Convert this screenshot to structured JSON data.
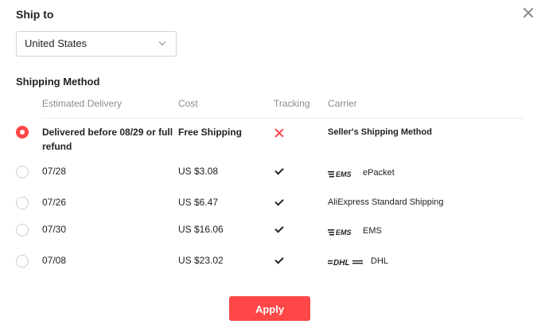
{
  "dialog": {
    "ship_to_label": "Ship to",
    "country": "United States",
    "shipping_method_label": "Shipping Method",
    "apply_label": "Apply"
  },
  "columns": {
    "delivery": "Estimated Delivery",
    "cost": "Cost",
    "tracking": "Tracking",
    "carrier": "Carrier"
  },
  "options": [
    {
      "delivery": "Delivered before 08/29 or full refund",
      "cost": "Free Shipping",
      "tracking": false,
      "carrier": "Seller's Shipping Method",
      "selected": true
    },
    {
      "delivery": "07/28",
      "cost": "US $3.08",
      "tracking": true,
      "carrier": "ePacket",
      "logo": "ems-logo",
      "selected": false
    },
    {
      "delivery": "07/26",
      "cost": "US $6.47",
      "tracking": true,
      "carrier": "AliExpress Standard Shipping",
      "selected": false
    },
    {
      "delivery": "07/30",
      "cost": "US $16.06",
      "tracking": true,
      "carrier": "EMS",
      "logo": "ems-logo",
      "selected": false
    },
    {
      "delivery": "07/08",
      "cost": "US $23.02",
      "tracking": true,
      "carrier": "DHL",
      "logo": "dhl-logo",
      "selected": false
    }
  ],
  "colors": {
    "accent": "#ff4747"
  }
}
